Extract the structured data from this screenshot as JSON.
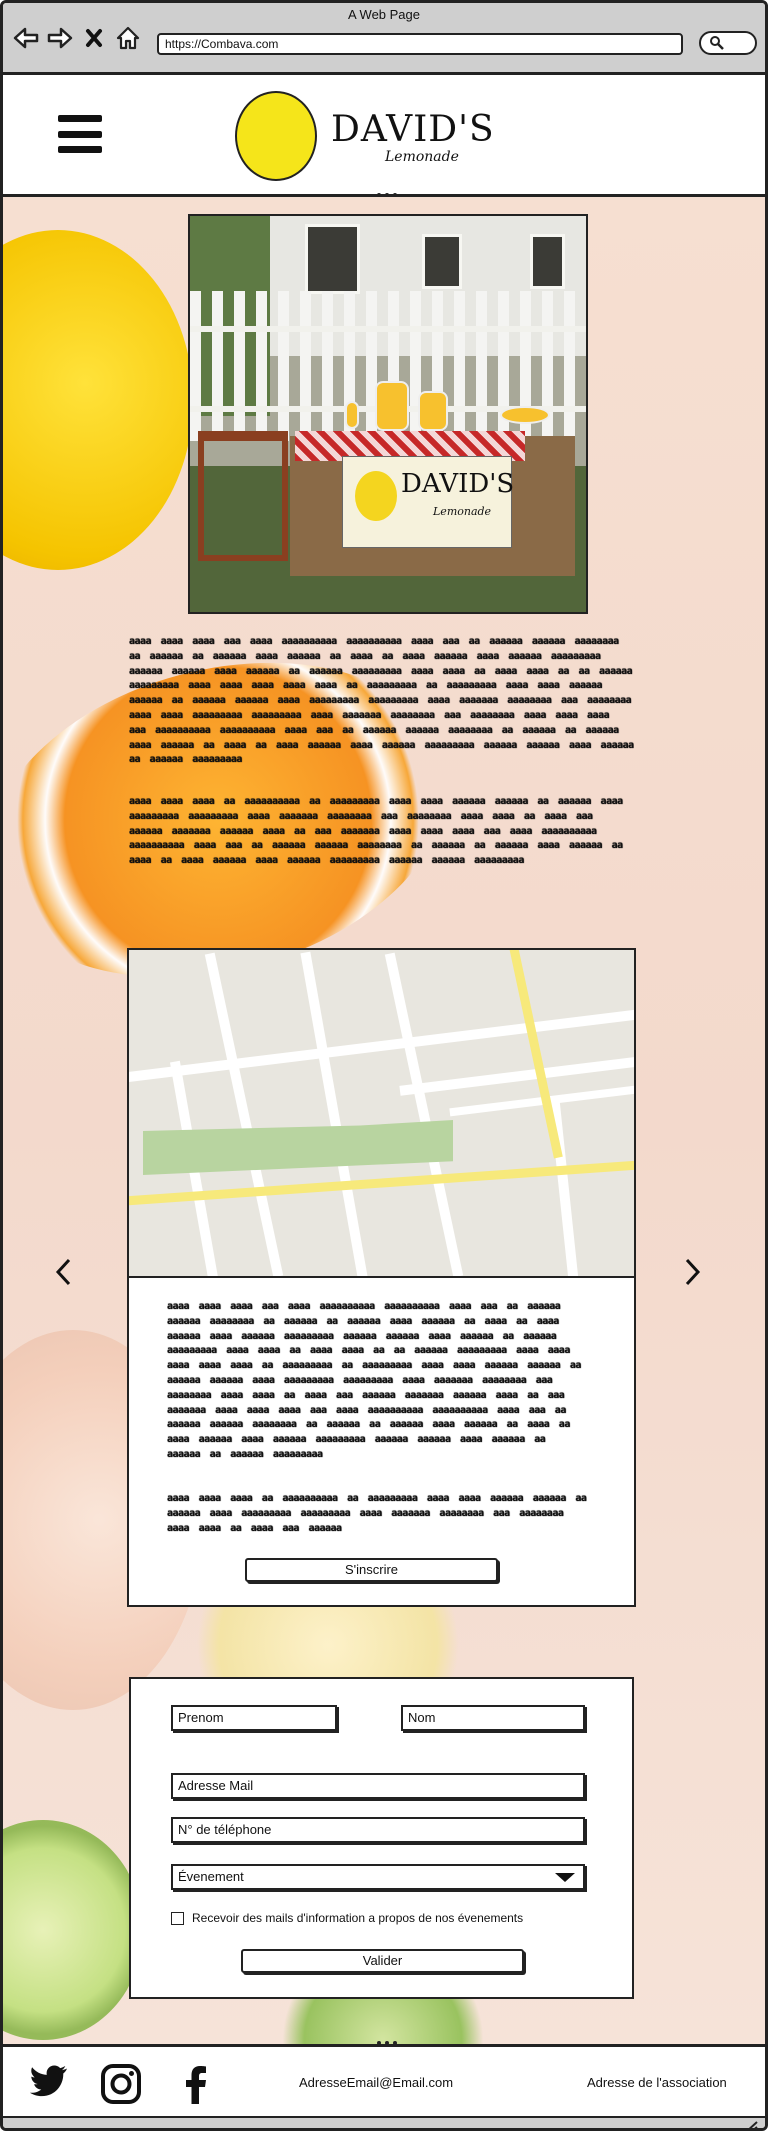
{
  "browser": {
    "title": "A Web Page",
    "url": "https://Combava.com"
  },
  "header": {
    "logo_text": "DAVID'S",
    "logo_subtext": "Lemonade"
  },
  "photo": {
    "sign_text": "DAVID'S",
    "sign_subtext": "Lemonade"
  },
  "intro": {
    "paragraph_1": "aaaa aaaa aaaa aaa aaaa aaaaaaaaaa aaaaaaaaaa aaaa aaa aa aaaaaa aaaaaa aaaaaaaa aa aaaaaa aa aaaaaa aaaa aaaaaa aa aaaa aa aaaa aaaaaa aaaa aaaaaa aaaaaaaaa aaaaaa aaaaaa aaaa aaaaaa aa aaaaaa aaaaaaaaa aaaa aaaa aa aaaa aaaa aa aa aaaaaa aaaaaaaaa aaaa aaaa aaaa aaaa aaaa aa aaaaaaaaa aa aaaaaaaaa aaaa aaaa aaaaaa aaaaaa aa aaaaaa aaaaaa aaaa aaaaaaaaa aaaaaaaaa aaaa aaaaaaa aaaaaaaa aaa aaaaaaaa aaaa aaaa aaaaaaaaa aaaaaaaaa aaaa aaaaaaa aaaaaaaa aaa aaaaaaaa aaaa aaaa aaaa aaa aaaaaaaaaa aaaaaaaaaa aaaa aaa aa aaaaaa aaaaaa aaaaaaaa aa aaaaaa aa aaaaaa aaaa aaaaaa aa aaaa aa aaaa aaaaaa aaaa aaaaaa aaaaaaaaa aaaaaa aaaaaa aaaa aaaaaa aa aaaaaa aaaaaaaaa",
    "paragraph_2": "aaaa aaaa aaaa aa aaaaaaaaaa aa aaaaaaaaa aaaa aaaa aaaaaa aaaaaa aa aaaaaa aaaa aaaaaaaaa aaaaaaaaa aaaa aaaaaaa aaaaaaaa aaa aaaaaaaa aaaa aaaa aa aaaa aaa aaaaaa aaaaaaa aaaaaa aaaa aa aaa aaaaaaa aaaa aaaa aaaa aaa aaaa aaaaaaaaaa aaaaaaaaaa aaaa aaa aa aaaaaa aaaaaa aaaaaaaa aa aaaaaa aa aaaaaa aaaa aaaaaa aa aaaa aa aaaa aaaaaa aaaa aaaaaa aaaaaaaaa aaaaaa aaaaaa aaaaaaaaa"
  },
  "event_card": {
    "paragraph_1": "aaaa aaaa aaaa aaa aaaa aaaaaaaaaa aaaaaaaaaa aaaa aaa aa aaaaaa aaaaaa aaaaaaaa aa aaaaaa aa aaaaaa aaaa aaaaaa aa aaaa aa aaaa aaaaaa aaaa aaaaaa aaaaaaaaa aaaaaa aaaaaa aaaa aaaaaa aa aaaaaa aaaaaaaaa aaaa aaaa aa aaaa aaaa aa aa aaaaaa aaaaaaaaa aaaa aaaa aaaa aaaa aaaa aa aaaaaaaaa aa aaaaaaaaa aaaa aaaa aaaaaa aaaaaa aa aaaaaa aaaaaa aaaa aaaaaaaaa aaaaaaaaa aaaa aaaaaaa aaaaaaaa aaa aaaaaaaa aaaa aaaa aa aaaa aaa aaaaaa aaaaaaa aaaaaa aaaa aa aaa aaaaaaa aaaa aaaa aaaa aaa aaaa aaaaaaaaaa aaaaaaaaaa aaaa aaa aa aaaaaa aaaaaa aaaaaaaa aa aaaaaa aa aaaaaa aaaa aaaaaa aa aaaa aa aaaa aaaaaa aaaa aaaaaa aaaaaaaaa aaaaaa aaaaaa aaaa aaaaaa aa aaaaaa aa aaaaaa aaaaaaaaa",
    "paragraph_2": "aaaa aaaa aaaa aa aaaaaaaaaa aa aaaaaaaaa aaaa aaaa aaaaaa aaaaaa aa aaaaaa aaaa aaaaaaaaa aaaaaaaaa aaaa aaaaaaa aaaaaaaa aaa aaaaaaaa aaaa aaaa aa aaaa aaa aaaaaa",
    "button_label": "S'inscrire"
  },
  "form": {
    "prenom_placeholder": "Prenom",
    "nom_placeholder": "Nom",
    "email_placeholder": "Adresse Mail",
    "phone_placeholder": "N° de téléphone",
    "event_select_value": "Évenement",
    "checkbox_label": "Recevoir des mails d'information a propos de nos évenements",
    "submit_label": "Valider"
  },
  "footer": {
    "email": "AdresseEmail@Email.com",
    "address": "Adresse de l'association"
  },
  "icons": [
    "back-icon",
    "forward-icon",
    "stop-icon",
    "home-icon",
    "search-icon",
    "menu-icon",
    "prev-arrow-icon",
    "next-arrow-icon",
    "dropdown-icon",
    "twitter-icon",
    "instagram-icon",
    "facebook-icon",
    "resize-icon"
  ]
}
